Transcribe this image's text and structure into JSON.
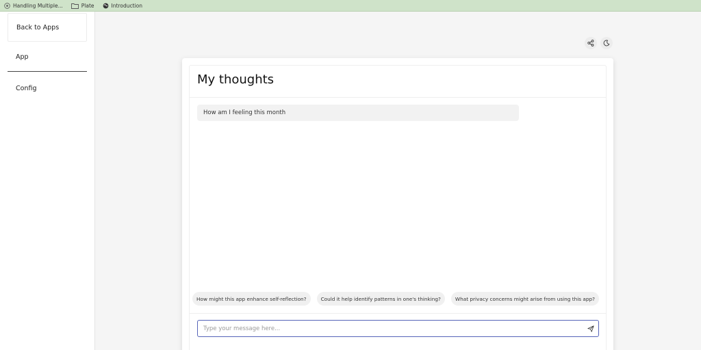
{
  "bookmarks": [
    {
      "label": "Handling Multiple...",
      "icon": "github-icon"
    },
    {
      "label": "Plate",
      "icon": "folder-icon"
    },
    {
      "label": "Introduction",
      "icon": "globe-icon"
    }
  ],
  "sidebar": {
    "back_label": "Back to Apps",
    "app_label": "App",
    "config_label": "Config"
  },
  "main": {
    "title": "My thoughts",
    "messages": [
      "How am I feeling this month"
    ],
    "suggestions": [
      "How might this app enhance self-reflection?",
      "Could it help identify patterns in one's thinking?",
      "What privacy concerns might arise from using this app?"
    ],
    "input_placeholder": "Type your message here...",
    "input_value": ""
  },
  "icons": {
    "share": "share-icon",
    "theme": "moon-icon",
    "send": "send-icon"
  },
  "colors": {
    "bookmarks_bar": "#cfe3c9",
    "input_focus": "#5563b8"
  }
}
